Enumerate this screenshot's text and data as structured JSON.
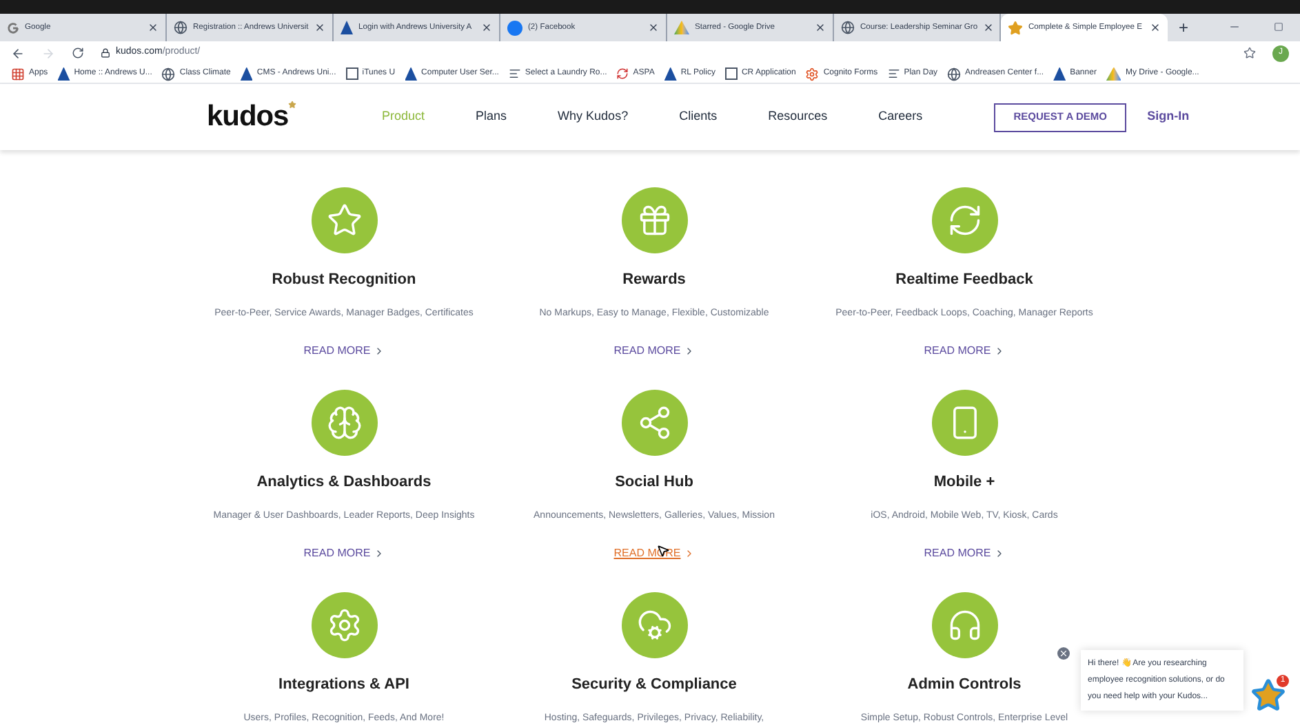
{
  "browser": {
    "tabs": [
      {
        "title": "Google",
        "kind": "google",
        "selected": false
      },
      {
        "title": "Registration :: Andrews Universit",
        "kind": "globe",
        "selected": false
      },
      {
        "title": "Login with Andrews University A",
        "kind": "au",
        "selected": false
      },
      {
        "title": "(2) Facebook",
        "kind": "fb",
        "selected": false
      },
      {
        "title": "Starred - Google Drive",
        "kind": "drive",
        "selected": false
      },
      {
        "title": "Course: Leadership Seminar Gro",
        "kind": "globe",
        "selected": false
      },
      {
        "title": "Complete & Simple Employee E",
        "kind": "star",
        "selected": true
      }
    ],
    "new_tab": "+",
    "address": {
      "host": "kudos.com",
      "path": "/product/"
    },
    "profile_initial": "J",
    "bookmarks": [
      {
        "label": "Apps",
        "kind": "apps"
      },
      {
        "label": "Home :: Andrews U...",
        "kind": "au"
      },
      {
        "label": "Class Climate",
        "kind": "globe"
      },
      {
        "label": "CMS - Andrews Uni...",
        "kind": "au"
      },
      {
        "label": "iTunes U",
        "kind": "box"
      },
      {
        "label": "Computer User Ser...",
        "kind": "au"
      },
      {
        "label": "Select a Laundry Ro...",
        "kind": "text"
      },
      {
        "label": "ASPA",
        "kind": "aspa"
      },
      {
        "label": "RL Policy",
        "kind": "au"
      },
      {
        "label": "CR Application",
        "kind": "box"
      },
      {
        "label": "Cognito Forms",
        "kind": "gear"
      },
      {
        "label": "Plan Day",
        "kind": "text"
      },
      {
        "label": "Andreasen Center f...",
        "kind": "globe"
      },
      {
        "label": "Banner",
        "kind": "au"
      },
      {
        "label": "My Drive - Google...",
        "kind": "drive"
      }
    ]
  },
  "site": {
    "logo": "kudos",
    "nav": [
      {
        "label": "Product",
        "selected": true
      },
      {
        "label": "Plans",
        "selected": false
      },
      {
        "label": "Why Kudos?",
        "selected": false
      },
      {
        "label": "Clients",
        "selected": false
      },
      {
        "label": "Resources",
        "selected": false
      },
      {
        "label": "Careers",
        "selected": false
      }
    ],
    "demo_button": "REQUEST A DEMO",
    "sign_in": "Sign-In"
  },
  "features": [
    {
      "kind": "star",
      "title": "Robust Recognition",
      "description": "Peer-to-Peer, Service Awards, Manager Badges, Certificates",
      "link": "READ MORE",
      "hovered": false
    },
    {
      "kind": "gift",
      "title": "Rewards",
      "description": "No Markups, Easy to Manage, Flexible, Customizable",
      "link": "READ MORE",
      "hovered": false
    },
    {
      "kind": "refresh",
      "title": "Realtime Feedback",
      "description": "Peer-to-Peer, Feedback Loops, Coaching, Manager Reports",
      "link": "READ MORE",
      "hovered": false
    },
    {
      "kind": "brain",
      "title": "Analytics & Dashboards",
      "description": "Manager & User Dashboards, Leader Reports, Deep Insights",
      "link": "READ MORE",
      "hovered": false
    },
    {
      "kind": "network",
      "title": "Social Hub",
      "description": "Announcements, Newsletters, Galleries, Values, Mission",
      "link": "READ MORE",
      "hovered": true
    },
    {
      "kind": "phone",
      "title": "Mobile +",
      "description": "iOS, Android, Mobile Web, TV, Kiosk, Cards",
      "link": "READ MORE",
      "hovered": false
    },
    {
      "kind": "gear",
      "title": "Integrations & API",
      "description": "Users, Profiles, Recognition, Feeds, And More!"
    },
    {
      "kind": "cloud",
      "title": "Security & Compliance",
      "description": "Hosting, Safeguards, Privileges, Privacy, Reliability,"
    },
    {
      "kind": "headset",
      "title": "Admin Controls",
      "description": "Simple Setup, Robust Controls, Enterprise Level"
    }
  ],
  "chat": {
    "message": "Hi there! 👋 Are you researching employee recognition solutions, or do you need help with your Kudos...",
    "badge": "1"
  }
}
